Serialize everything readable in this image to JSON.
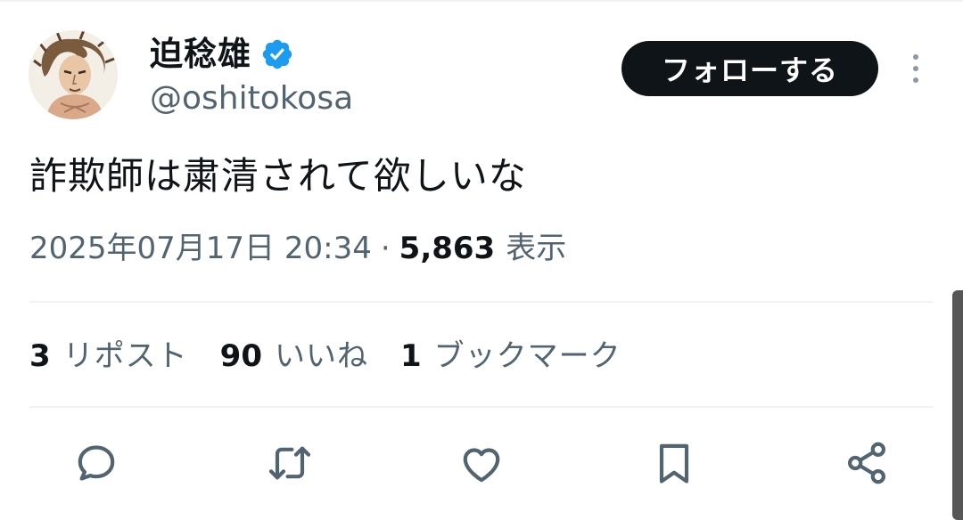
{
  "author": {
    "display_name": "迫稔雄",
    "handle": "@oshitokosa",
    "avatar_icon": "avatar-illustration",
    "verified_icon": "verified-badge-icon",
    "verified_color": "#1d9bf0"
  },
  "follow_button": {
    "label": "フォローする"
  },
  "more_icon": "more-vertical-icon",
  "tweet": {
    "text": "詐欺師は粛清されて欲しいな"
  },
  "meta": {
    "datetime": "2025年07月17日 20:34",
    "separator": "·",
    "views_count": "5,863",
    "views_label": "表示"
  },
  "stats": {
    "reposts_count": "3",
    "reposts_label": "リポスト",
    "likes_count": "90",
    "likes_label": "いいね",
    "bookmarks_count": "1",
    "bookmarks_label": "ブックマーク"
  },
  "actions": [
    "reply-icon",
    "repost-icon",
    "like-icon",
    "bookmark-icon",
    "share-icon"
  ],
  "colors": {
    "text_primary": "#0f1419",
    "text_secondary": "#536471",
    "divider": "#eff3f4",
    "button_bg": "#0f1419"
  }
}
